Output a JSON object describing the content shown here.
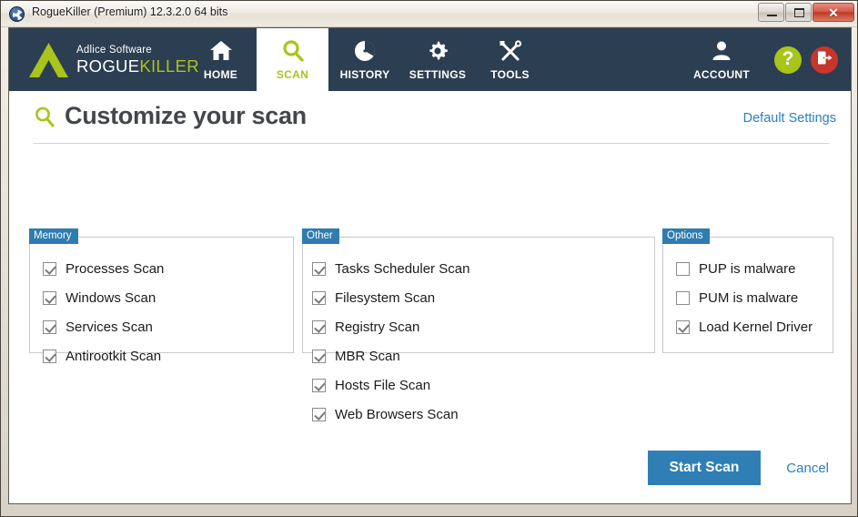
{
  "window": {
    "title": "RogueKiller (Premium) 12.3.2.0 64 bits",
    "app_icon": "roguekiller-radiation-icon",
    "controls": {
      "minimize": "minimize-icon",
      "maximize": "maximize-icon",
      "close": "✕"
    }
  },
  "navbar": {
    "brand": {
      "logo": "adlice-triangle-logo",
      "company": "Adlice Software",
      "name_white": "ROGUE",
      "name_green": "KILLER"
    },
    "tabs": [
      {
        "label": "HOME",
        "icon": "home-icon",
        "active": false
      },
      {
        "label": "SCAN",
        "icon": "search-icon",
        "active": true
      },
      {
        "label": "HISTORY",
        "icon": "clock-icon",
        "active": false
      },
      {
        "label": "SETTINGS",
        "icon": "gear-icon",
        "active": false
      },
      {
        "label": "TOOLS",
        "icon": "tools-icon",
        "active": false
      }
    ],
    "account": {
      "label": "ACCOUNT",
      "icon": "user-icon"
    },
    "help_button": {
      "glyph": "?",
      "icon": "help-icon",
      "color": "#a9c41a"
    },
    "exit_button": {
      "icon": "exit-door-icon",
      "color": "#c8352b"
    }
  },
  "page": {
    "title": "Customize your scan",
    "title_icon": "search-icon",
    "default_settings_link": "Default Settings"
  },
  "groups": [
    {
      "legend": "Memory",
      "columns": 1,
      "items": [
        {
          "label": "Processes Scan",
          "checked": true
        },
        {
          "label": "Windows Scan",
          "checked": true
        },
        {
          "label": "Services Scan",
          "checked": true
        },
        {
          "label": "Antirootkit Scan",
          "checked": true
        }
      ]
    },
    {
      "legend": "Other",
      "columns": 2,
      "items": [
        {
          "label": "Tasks Scheduler Scan",
          "checked": true
        },
        {
          "label": "Filesystem Scan",
          "checked": true
        },
        {
          "label": "Registry Scan",
          "checked": true
        },
        {
          "label": "MBR Scan",
          "checked": true
        },
        {
          "label": "Hosts File Scan",
          "checked": true
        },
        {
          "label": "Web Browsers Scan",
          "checked": true
        }
      ]
    },
    {
      "legend": "Options",
      "columns": 1,
      "items": [
        {
          "label": "PUP is malware",
          "checked": false
        },
        {
          "label": "PUM is malware",
          "checked": false
        },
        {
          "label": "Load Kernel Driver",
          "checked": true
        }
      ]
    }
  ],
  "footer": {
    "start_scan": "Start Scan",
    "cancel": "Cancel"
  },
  "colors": {
    "navbar": "#2c3e52",
    "accent_green": "#a9c41a",
    "accent_blue": "#2f7fb5",
    "link_blue": "#2e7fbd",
    "legend_blue": "#2e7cb0",
    "exit_red": "#c8352b"
  }
}
